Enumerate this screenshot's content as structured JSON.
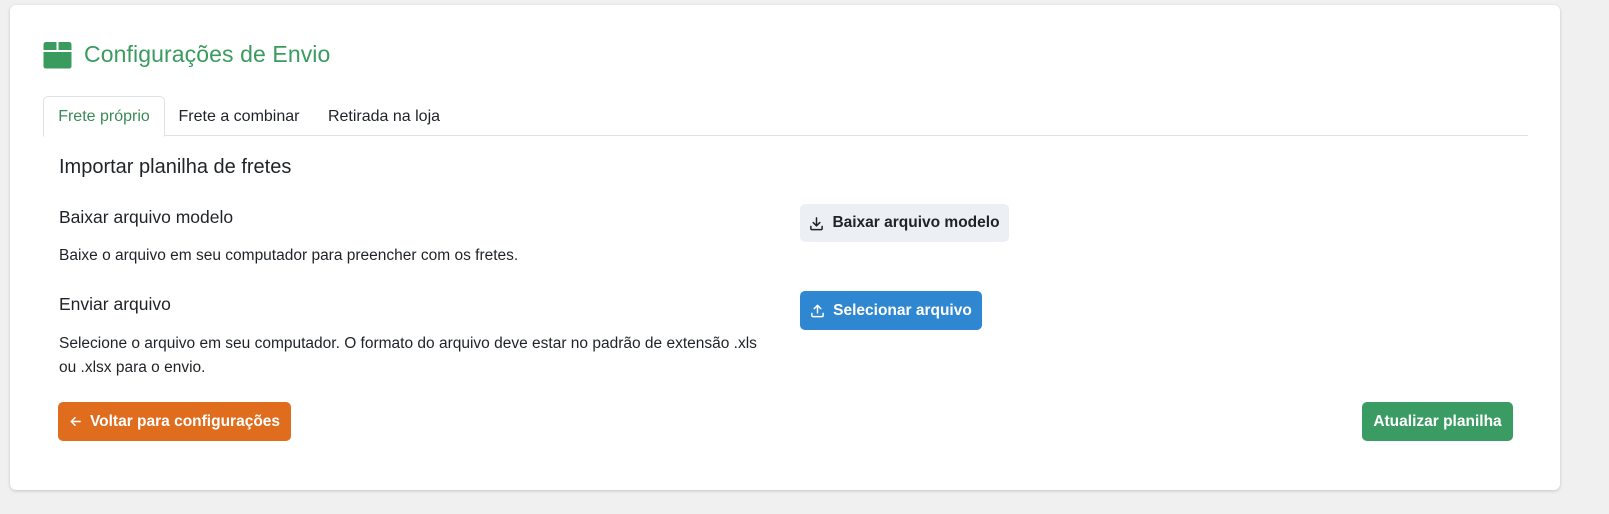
{
  "header": {
    "icon": "box-icon",
    "title": "Configurações de Envio",
    "accent_color": "#3a9b5f"
  },
  "tabs": [
    {
      "label": "Frete próprio",
      "active": true
    },
    {
      "label": "Frete a combinar",
      "active": false
    },
    {
      "label": "Retirada na loja",
      "active": false
    }
  ],
  "import": {
    "title": "Importar planilha de fretes",
    "download": {
      "label": "Baixar arquivo modelo",
      "description": "Baixe o arquivo em seu computador para preencher com os fretes.",
      "button_label": "Baixar arquivo modelo",
      "button_icon": "download-icon"
    },
    "upload": {
      "label": "Enviar arquivo",
      "description_line1": "Selecione o arquivo em seu computador. O formato do arquivo deve estar no padrão de extensão .xls",
      "description_line2": "ou .xlsx para o envio.",
      "button_label": "Selecionar arquivo",
      "button_icon": "upload-icon",
      "button_color": "#2f86d1"
    }
  },
  "footer": {
    "back_label": "Voltar para configurações",
    "back_icon": "arrow-left-icon",
    "back_color": "#e06d1e",
    "submit_label": "Atualizar planilha",
    "submit_color": "#3a9b63"
  }
}
